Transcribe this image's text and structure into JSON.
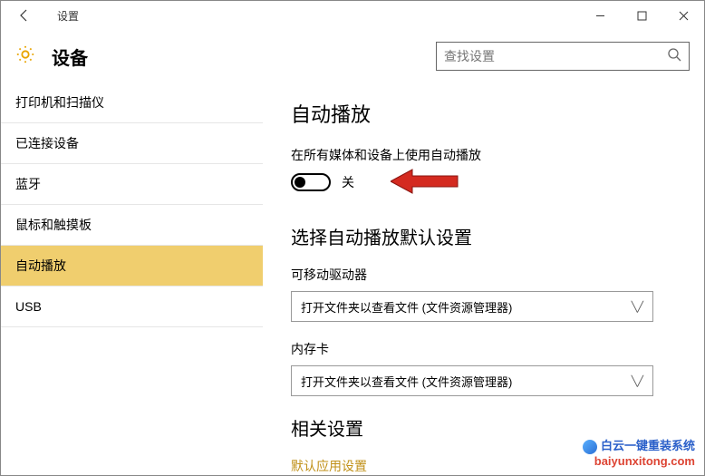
{
  "titlebar": {
    "title": "设置"
  },
  "header": {
    "title": "设备",
    "search_placeholder": "查找设置"
  },
  "sidebar": {
    "items": [
      {
        "label": "打印机和扫描仪",
        "selected": false
      },
      {
        "label": "已连接设备",
        "selected": false
      },
      {
        "label": "蓝牙",
        "selected": false
      },
      {
        "label": "鼠标和触摸板",
        "selected": false
      },
      {
        "label": "自动播放",
        "selected": true
      },
      {
        "label": "USB",
        "selected": false
      }
    ]
  },
  "main": {
    "heading_autoplay": "自动播放",
    "autoplay_desc": "在所有媒体和设备上使用自动播放",
    "toggle_state": "关",
    "heading_defaults": "选择自动播放默认设置",
    "removable_label": "可移动驱动器",
    "removable_value": "打开文件夹以查看文件 (文件资源管理器)",
    "memcard_label": "内存卡",
    "memcard_value": "打开文件夹以查看文件 (文件资源管理器)",
    "heading_related": "相关设置",
    "related_link": "默认应用设置"
  },
  "watermark": {
    "title": "白云一键重装系统",
    "url": "baiyunxitong.com"
  }
}
